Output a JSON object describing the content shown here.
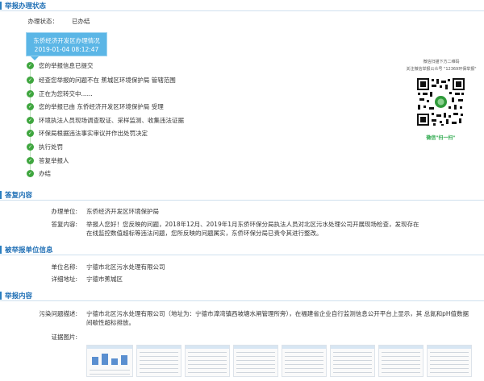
{
  "sections": {
    "status": "举报办理状态",
    "reply": "答复内容",
    "reported": "被举报单位信息",
    "report": "举报内容"
  },
  "status": {
    "label": "办理状态：",
    "value": "已办结",
    "box_unit": "东侨经济开发区办理情况",
    "box_time": "2019-01-04 08:12:47",
    "steps": [
      "您的举报信息已提交",
      "经查您举报的问题不在 蕉城区环境保护局 管辖范围",
      "正在为您转交中......",
      "您的举报已由 东侨经济开发区环境保护局 受理",
      "环境执法人员现场调查取证、采样监测、收集违法证据",
      "环保局根据违法事实审议并作出处罚决定",
      "执行处罚",
      "答复举报人",
      "办结"
    ]
  },
  "qr": {
    "caption1": "微信扫描下方二维码",
    "caption2": "关注微信举报公众号 \"12369环保举报\"",
    "footer": "微信\"扫一扫\""
  },
  "reply": {
    "unit_label": "办理单位:",
    "unit_value": "东侨经济开发区环境保护局",
    "content_label": "答复内容:",
    "content_value": "举报人您好！您反映的问题，2018年12月、2019年1月东侨环保分局执法人员对北区污水处理公司开展现场检查，发现存在在线监控数值超标等违法问题，您所反映的问题属实，东侨环保分局已责令其进行整改。"
  },
  "reported": {
    "name_label": "单位名称:",
    "name_value": "宁德市北区污水处理有限公司",
    "addr_label": "详细地址:",
    "addr_value": "宁德市蕉城区"
  },
  "report": {
    "problem_label": "污染问题描述:",
    "problem_value": "宁德市北区污水处理有限公司（地址为：宁德市漳湾镇西坡塘水闸管理所旁），在福建省企业自行监测信息公开平台上显示，其 总氮和pH值数据 间歇性超标排放。",
    "evidence_label": "证据图片:"
  },
  "colors": {
    "accent": "#1f6fb5",
    "status_box": "#5bb6e6",
    "step_green": "#3fa63f"
  }
}
